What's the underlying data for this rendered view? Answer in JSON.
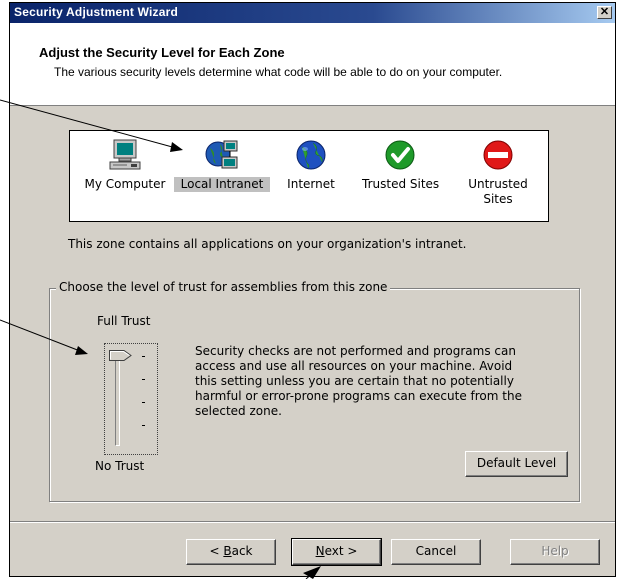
{
  "window": {
    "title": "Security Adjustment Wizard",
    "close_glyph": "✕"
  },
  "header": {
    "title": "Adjust the Security Level for Each Zone",
    "description": "The various security levels determine what code will be able to do on your computer."
  },
  "zones": [
    {
      "label": "My Computer",
      "icon": "computer-icon",
      "selected": false
    },
    {
      "label": "Local Intranet",
      "icon": "network-globe-icon",
      "selected": true
    },
    {
      "label": "Internet",
      "icon": "globe-icon",
      "selected": false
    },
    {
      "label": "Trusted Sites",
      "icon": "checkmark-icon",
      "selected": false
    },
    {
      "label": "Untrusted Sites",
      "icon": "no-entry-icon",
      "selected": false
    }
  ],
  "zone_description": "This zone contains all applications on your organization's intranet.",
  "trust_group": {
    "legend": "Choose the level of trust for assemblies from this zone",
    "top_label": "Full Trust",
    "bottom_label": "No Trust",
    "level": "Full Trust",
    "description": "Security checks are not performed and programs can access and use all resources on your machine.  Avoid this setting unless you are certain that no potentially harmful or error-prone programs can execute from the selected zone.",
    "default_button": "Default Level"
  },
  "buttons": {
    "back": {
      "label": "Back",
      "prefix": "< ",
      "mnemonic": "B",
      "rest": "ack"
    },
    "next": {
      "label": "Next",
      "suffix": " >",
      "mnemonic": "N",
      "rest": "ext"
    },
    "cancel": "Cancel",
    "help": "Help"
  },
  "colors": {
    "title_bar": "#0a246a",
    "dialog_face": "#d4d0c8",
    "selection": "#c0c0c0"
  }
}
